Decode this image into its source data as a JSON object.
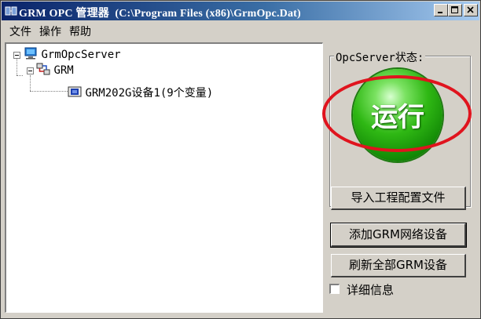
{
  "window": {
    "title": "GRM OPC 管理器  (C:\\Program Files (x86)\\GrmOpc.Dat)",
    "icon": "grm-app-icon",
    "controls": [
      "minimize-icon",
      "maximize-icon",
      "close-icon"
    ]
  },
  "menu": {
    "items": [
      {
        "label": "文件"
      },
      {
        "label": "操作"
      },
      {
        "label": "帮助"
      }
    ]
  },
  "tree": {
    "root": {
      "label": "GrmOpcServer",
      "icon": "computer-icon",
      "expanded": true
    },
    "group": {
      "label": "GRM",
      "icon": "network-icon",
      "expanded": true
    },
    "device": {
      "label": "GRM202G设备1(9个变量)",
      "icon": "device-icon"
    }
  },
  "status": {
    "group_label": "OpcServer状态:",
    "indicator_text": "运行",
    "indicator_color": "#2fb814",
    "highlight_color": "#e0141e"
  },
  "buttons": {
    "import": "导入工程配置文件",
    "add": "添加GRM网络设备",
    "refresh": "刷新全部GRM设备"
  },
  "options": {
    "details_label": "详细信息",
    "details_checked": false
  }
}
